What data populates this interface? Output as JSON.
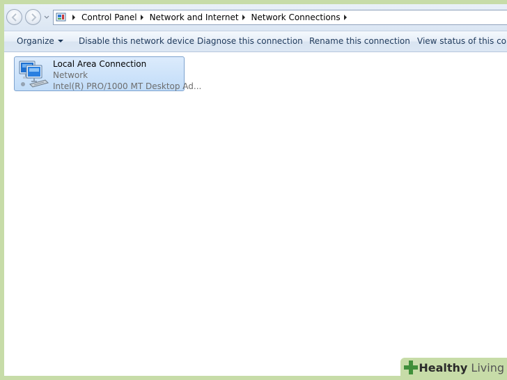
{
  "address_bar": {
    "crumbs": [
      "Control Panel",
      "Network and Internet",
      "Network Connections"
    ]
  },
  "toolbar": {
    "organize": "Organize",
    "disable": "Disable this network device",
    "diagnose": "Diagnose this connection",
    "rename": "Rename this connection",
    "view_status": "View status of this conn"
  },
  "connection": {
    "name": "Local Area Connection",
    "type": "Network",
    "adapter": "Intel(R) PRO/1000 MT Desktop Ad..."
  },
  "watermark": {
    "bold": "Healthy",
    "light": " Living"
  },
  "colors": {
    "frame_bg": "#c7dca8",
    "selection": "#c1dcf8",
    "brand_green": "#3f8f3a"
  }
}
